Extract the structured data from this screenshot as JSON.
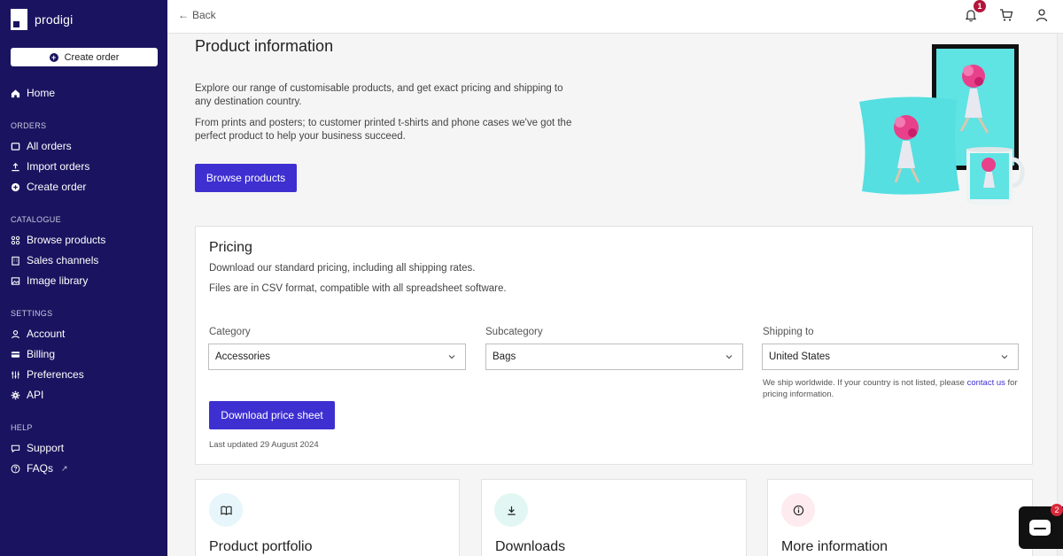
{
  "brand": {
    "name": "prodigi"
  },
  "sidebar": {
    "create_order": "Create order",
    "home": "Home",
    "sections": {
      "orders": "ORDERS",
      "catalogue": "CATALOGUE",
      "settings": "SETTINGS",
      "help": "HELP"
    },
    "orders": [
      "All orders",
      "Import orders",
      "Create order"
    ],
    "catalogue": [
      "Browse products",
      "Sales channels",
      "Image library"
    ],
    "settings": [
      "Account",
      "Billing",
      "Preferences",
      "API"
    ],
    "help": [
      "Support",
      "FAQs"
    ]
  },
  "topbar": {
    "back": "Back",
    "notification_count": "1"
  },
  "hero": {
    "title": "Product information",
    "para1": "Explore our range of customisable products, and get exact pricing and shipping to any destination country.",
    "para2": "From prints and posters; to customer printed t-shirts and phone cases we've got the perfect product to help your business succeed.",
    "button": "Browse products"
  },
  "pricing": {
    "title": "Pricing",
    "line1": "Download our standard pricing, including all shipping rates.",
    "line2": "Files are in CSV format, compatible with all spreadsheet software.",
    "category_label": "Category",
    "category_value": "Accessories",
    "subcategory_label": "Subcategory",
    "subcategory_value": "Bags",
    "shipping_label": "Shipping to",
    "shipping_value": "United States",
    "ship_note_pre": "We ship worldwide. If your country is not listed, please ",
    "ship_note_link": "contact us",
    "ship_note_post": " for pricing information.",
    "download_button": "Download price sheet",
    "last_updated": "Last updated 29 August 2024"
  },
  "cards": [
    {
      "title": "Product portfolio",
      "icon": "book-icon",
      "tint": "#e6f6fb"
    },
    {
      "title": "Downloads",
      "icon": "download-icon",
      "tint": "#e2f7f4"
    },
    {
      "title": "More information",
      "icon": "info-icon",
      "tint": "#fdebef"
    }
  ],
  "chat": {
    "badge": "2"
  },
  "colors": {
    "sidebar": "#1a1460",
    "accent": "#3e2fd1",
    "badge": "#b3153a"
  }
}
